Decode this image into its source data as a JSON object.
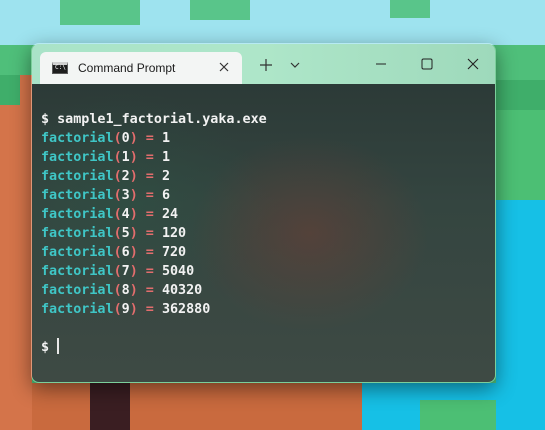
{
  "window": {
    "tab_title": "Command Prompt",
    "tab_icon": "terminal-icon",
    "new_tab_label": "+",
    "dropdown_label": "⌄"
  },
  "terminal": {
    "prompt_symbol": "$",
    "command": "sample1_factorial.yaka.exe",
    "function_name": "factorial",
    "results": [
      {
        "n": "0",
        "value": "1"
      },
      {
        "n": "1",
        "value": "1"
      },
      {
        "n": "2",
        "value": "2"
      },
      {
        "n": "3",
        "value": "6"
      },
      {
        "n": "4",
        "value": "24"
      },
      {
        "n": "5",
        "value": "120"
      },
      {
        "n": "6",
        "value": "720"
      },
      {
        "n": "7",
        "value": "5040"
      },
      {
        "n": "8",
        "value": "40320"
      },
      {
        "n": "9",
        "value": "362880"
      }
    ]
  },
  "colors": {
    "function": "#3fc6c6",
    "operator": "#e36d6d",
    "text": "#f2f2f2",
    "titlebar": "#aee6c9"
  }
}
